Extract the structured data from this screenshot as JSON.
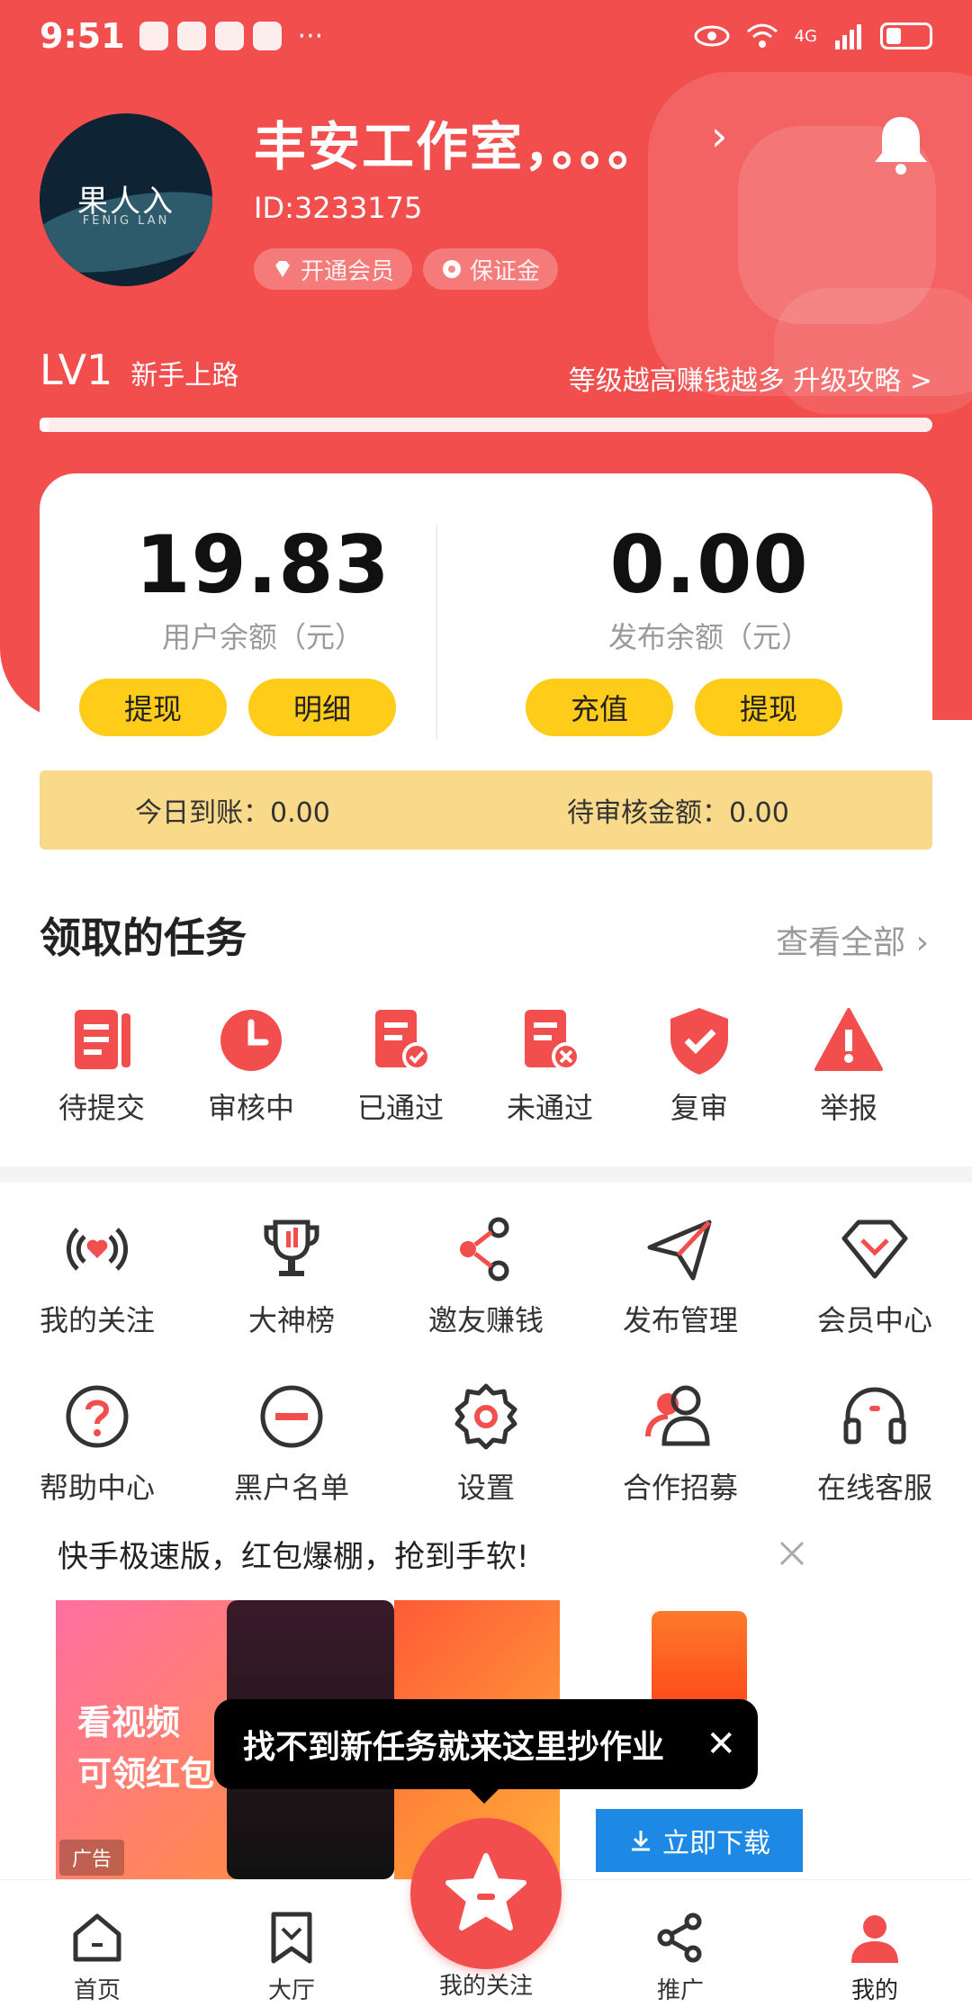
{
  "status": {
    "time": "9:51",
    "dots": "···",
    "network": "4G"
  },
  "profile": {
    "name": "丰安工作室，。。。",
    "id": "ID:3233175",
    "avatar_logo": "果人入",
    "avatar_sub": "FENIG LAN",
    "tags": [
      "开通会员",
      "保证金"
    ]
  },
  "level": {
    "lv": "LV1",
    "name": "新手上路",
    "upgrade": "等级越高赚钱越多 升级攻略 >",
    "progress": 0.01
  },
  "balance": {
    "user": {
      "amount": "19.83",
      "label": "用户余额（元）",
      "buttons": [
        "提现",
        "明细"
      ]
    },
    "publish": {
      "amount": "0.00",
      "label": "发布余额（元）",
      "buttons": [
        "充值",
        "提现"
      ]
    },
    "today": "今日到账：0.00",
    "pending": "待审核金额：0.00"
  },
  "tasks": {
    "title": "领取的任务",
    "more": "查看全部 ›",
    "items": [
      {
        "label": "待提交",
        "icon": "doc-list-icon"
      },
      {
        "label": "审核中",
        "icon": "clock-icon"
      },
      {
        "label": "已通过",
        "icon": "doc-check-icon"
      },
      {
        "label": "未通过",
        "icon": "doc-x-icon"
      },
      {
        "label": "复审",
        "icon": "shield-check-icon"
      },
      {
        "label": "举报",
        "icon": "warning-icon"
      }
    ]
  },
  "grid": {
    "row1": [
      "我的关注",
      "大神榜",
      "邀友赚钱",
      "发布管理",
      "会员中心"
    ],
    "row2": [
      "帮助中心",
      "黑户名单",
      "设置",
      "合作招募",
      "在线客服"
    ]
  },
  "ad": {
    "title": "快手极速版，红包爆棚，抢到手软!",
    "image_text": [
      "看视频",
      "可领红包"
    ],
    "label": "广告",
    "download": "立即下载"
  },
  "tooltip": {
    "text": "找不到新任务就来这里抄作业",
    "close": "✕"
  },
  "nav": {
    "items": [
      "首页",
      "大厅",
      "我的关注",
      "推广",
      "我的"
    ]
  },
  "colors": {
    "primary": "#f24e4e",
    "yellow": "#ffcc1a",
    "banner": "#f9d98a"
  }
}
